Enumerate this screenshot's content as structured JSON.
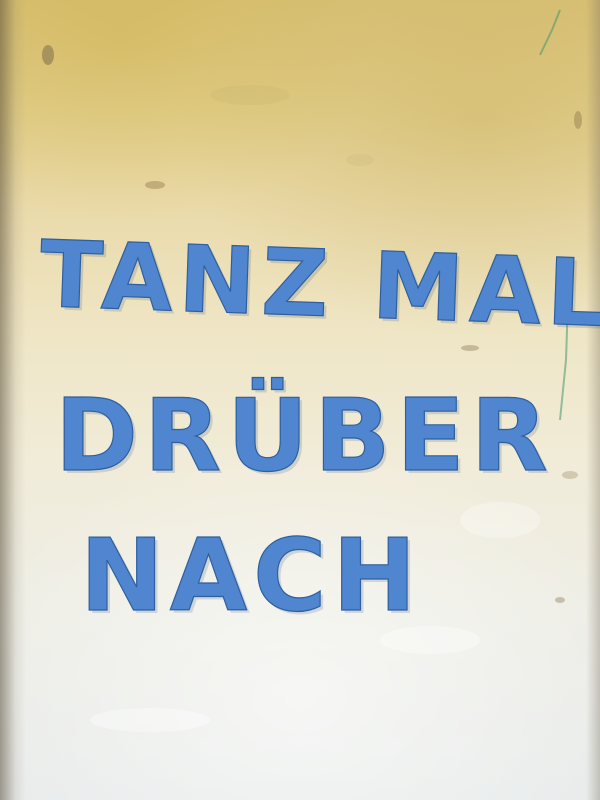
{
  "graffiti": {
    "line1": "TANZ MAL",
    "line2": "DRÜBER",
    "line3": "NACH"
  },
  "colors": {
    "chalk": "#4f86cf",
    "wall_top": "#d9c278",
    "wall_bottom": "#e8ebeb"
  }
}
